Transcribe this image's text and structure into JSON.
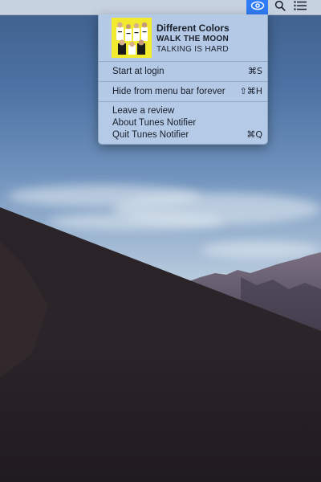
{
  "now_playing": {
    "title": "Different Colors",
    "artist": "WALK THE MOON",
    "album": "TALKING IS HARD",
    "album_art_lettering": "TALKING IS HARD",
    "album_art_color": "#f2ea2e"
  },
  "menu": {
    "items": [
      {
        "label": "Start at login",
        "shortcut": "⌘S"
      },
      {
        "label": "Hide from menu bar forever",
        "shortcut": "⇧⌘H"
      },
      {
        "label": "Leave a review",
        "shortcut": ""
      },
      {
        "label": "About Tunes Notifier",
        "shortcut": ""
      },
      {
        "label": "Quit Tunes Notifier",
        "shortcut": "⌘Q"
      }
    ]
  },
  "menubar": {
    "icons": [
      "eye-icon",
      "search-icon",
      "list-icon"
    ],
    "active_icon": "eye-icon",
    "active_color": "#2f7cf6"
  }
}
